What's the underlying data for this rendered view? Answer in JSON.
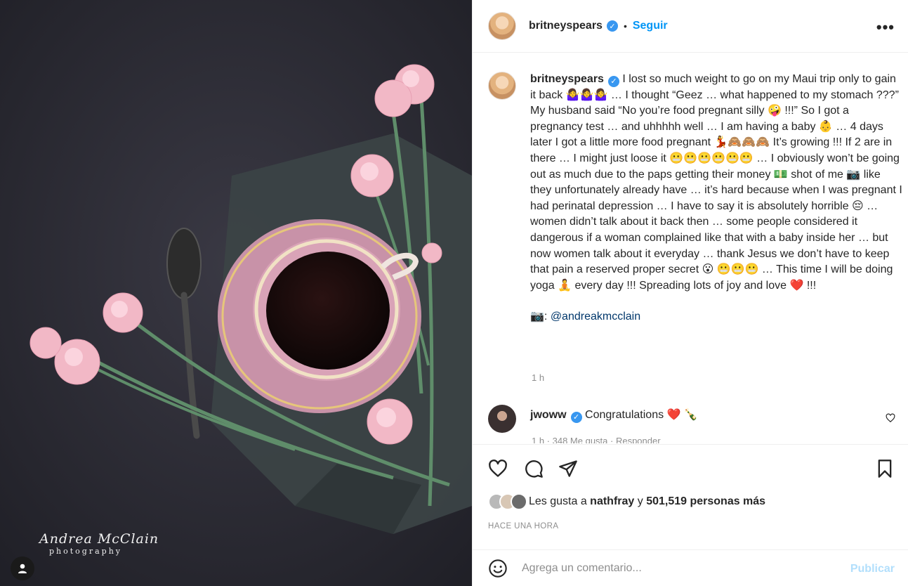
{
  "post": {
    "photo_alt": "Pink carnations and a pink teacup of black coffee on a dark surface",
    "watermark_main": "Andrea McClain",
    "watermark_sub": "photography"
  },
  "header": {
    "username": "britneyspears",
    "verified_glyph": "✓",
    "separator": "•",
    "follow_label": "Seguir",
    "more_glyph": "•••"
  },
  "caption": {
    "username": "britneyspears",
    "text": "I lost so much weight to go on my Maui trip only to gain it back 🤷‍♀️🤷‍♀️🤷‍♀️ … I thought “Geez … what happened to my stomach ???” My husband said “No you’re food pregnant silly 🤪 !!!” So I got a pregnancy test … and uhhhhh well … I am having a baby 👶 … 4 days later I got a little more food pregnant 💃🙈🙈🙈 It’s growing !!! If 2 are in there … I might just loose it 😬😬😬😬😬😬 … I obviously won’t be going out as much due to the paps getting their money 💵 shot of me 📷 like they unfortunately already have … it’s hard because when I was pregnant I had perinatal depression … I have to say it is absolutely horrible 😔 … women didn’t talk about it back then … some people considered it dangerous if a woman complained like that with a baby inside her … but now women talk about it everyday … thank Jesus we don’t have to keep that pain a reserved proper secret 😮 😬😬😬 … This time I will be doing yoga 🧘 every day !!! Spreading lots of joy and love ❤️ !!!",
    "credit_prefix": "📷: ",
    "credit_mention": "@andreakmcclain",
    "time": "1 h"
  },
  "comment": {
    "username": "jwoww",
    "text": "Congratulations ❤️ 🍾",
    "meta": "1 h · 348 Me gusta · Responder"
  },
  "likes": {
    "prefix": "Les gusta a ",
    "first_user": "nathfray",
    "middle": " y ",
    "count": "501,519 personas más"
  },
  "post_time": "HACE UNA HORA",
  "add_comment": {
    "placeholder": "Agrega un comentario...",
    "post_label": "Publicar"
  },
  "icons": {
    "like": "heart-icon",
    "comment": "comment-icon",
    "share": "paper-plane-icon",
    "save": "bookmark-icon",
    "emoji": "smiley-icon",
    "user_tag": "user-icon"
  },
  "colors": {
    "accent": "#0095f6",
    "mention": "#00376b",
    "muted": "#8e8e8e",
    "post_disabled": "#b2dffc"
  }
}
